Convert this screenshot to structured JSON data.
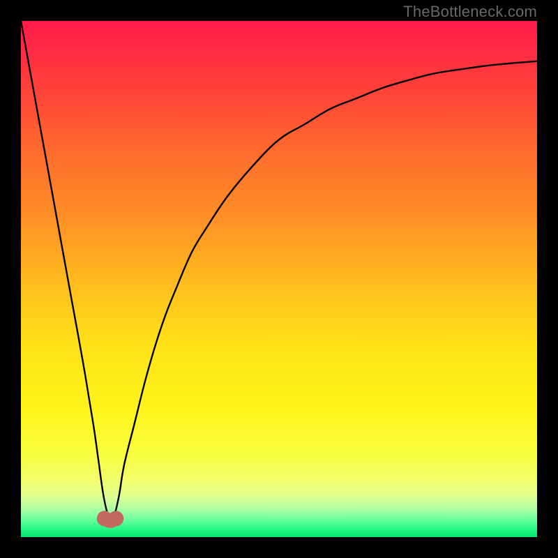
{
  "watermark": {
    "text": "TheBottleneck.com"
  },
  "chart_data": {
    "type": "line",
    "title": "",
    "xlabel": "",
    "ylabel": "",
    "xlim": [
      0,
      100
    ],
    "ylim": [
      0,
      100
    ],
    "grid": false,
    "series": [
      {
        "name": "bottleneck-curve",
        "x": [
          0,
          2,
          4,
          6,
          8,
          10,
          12,
          14,
          15,
          16,
          17,
          18,
          19,
          20,
          22,
          24,
          26,
          28,
          30,
          33,
          36,
          40,
          45,
          50,
          55,
          60,
          65,
          70,
          75,
          80,
          85,
          90,
          95,
          100
        ],
        "y": [
          100,
          89,
          78,
          67,
          56,
          45,
          34,
          22,
          15,
          8,
          4,
          4,
          8,
          14,
          22,
          30,
          37,
          43,
          48,
          55,
          60,
          66,
          72,
          77,
          80,
          83,
          85,
          87,
          88.5,
          89.8,
          90.6,
          91.3,
          91.8,
          92.2
        ]
      }
    ],
    "markers": [
      {
        "name": "optimum-left",
        "x": 16.2,
        "y": 3.6,
        "color": "#c26a62",
        "r": 1.5
      },
      {
        "name": "optimum-right",
        "x": 18.4,
        "y": 3.6,
        "color": "#c26a62",
        "r": 1.5
      }
    ],
    "background_gradient": {
      "stops": [
        {
          "pct": 0,
          "color": "#ff1a4b"
        },
        {
          "pct": 12,
          "color": "#ff3e3a"
        },
        {
          "pct": 25,
          "color": "#ff6a2e"
        },
        {
          "pct": 38,
          "color": "#ff8f26"
        },
        {
          "pct": 50,
          "color": "#ffb91e"
        },
        {
          "pct": 62,
          "color": "#ffe019"
        },
        {
          "pct": 75,
          "color": "#fff41b"
        },
        {
          "pct": 84,
          "color": "#f8ff40"
        },
        {
          "pct": 89,
          "color": "#f2ff6e"
        },
        {
          "pct": 92,
          "color": "#e0ff8f"
        },
        {
          "pct": 94,
          "color": "#b8ffa0"
        },
        {
          "pct": 95.5,
          "color": "#90ffa4"
        },
        {
          "pct": 97,
          "color": "#5bff98"
        },
        {
          "pct": 98.3,
          "color": "#2cf987"
        },
        {
          "pct": 100,
          "color": "#05e46f"
        }
      ]
    }
  }
}
